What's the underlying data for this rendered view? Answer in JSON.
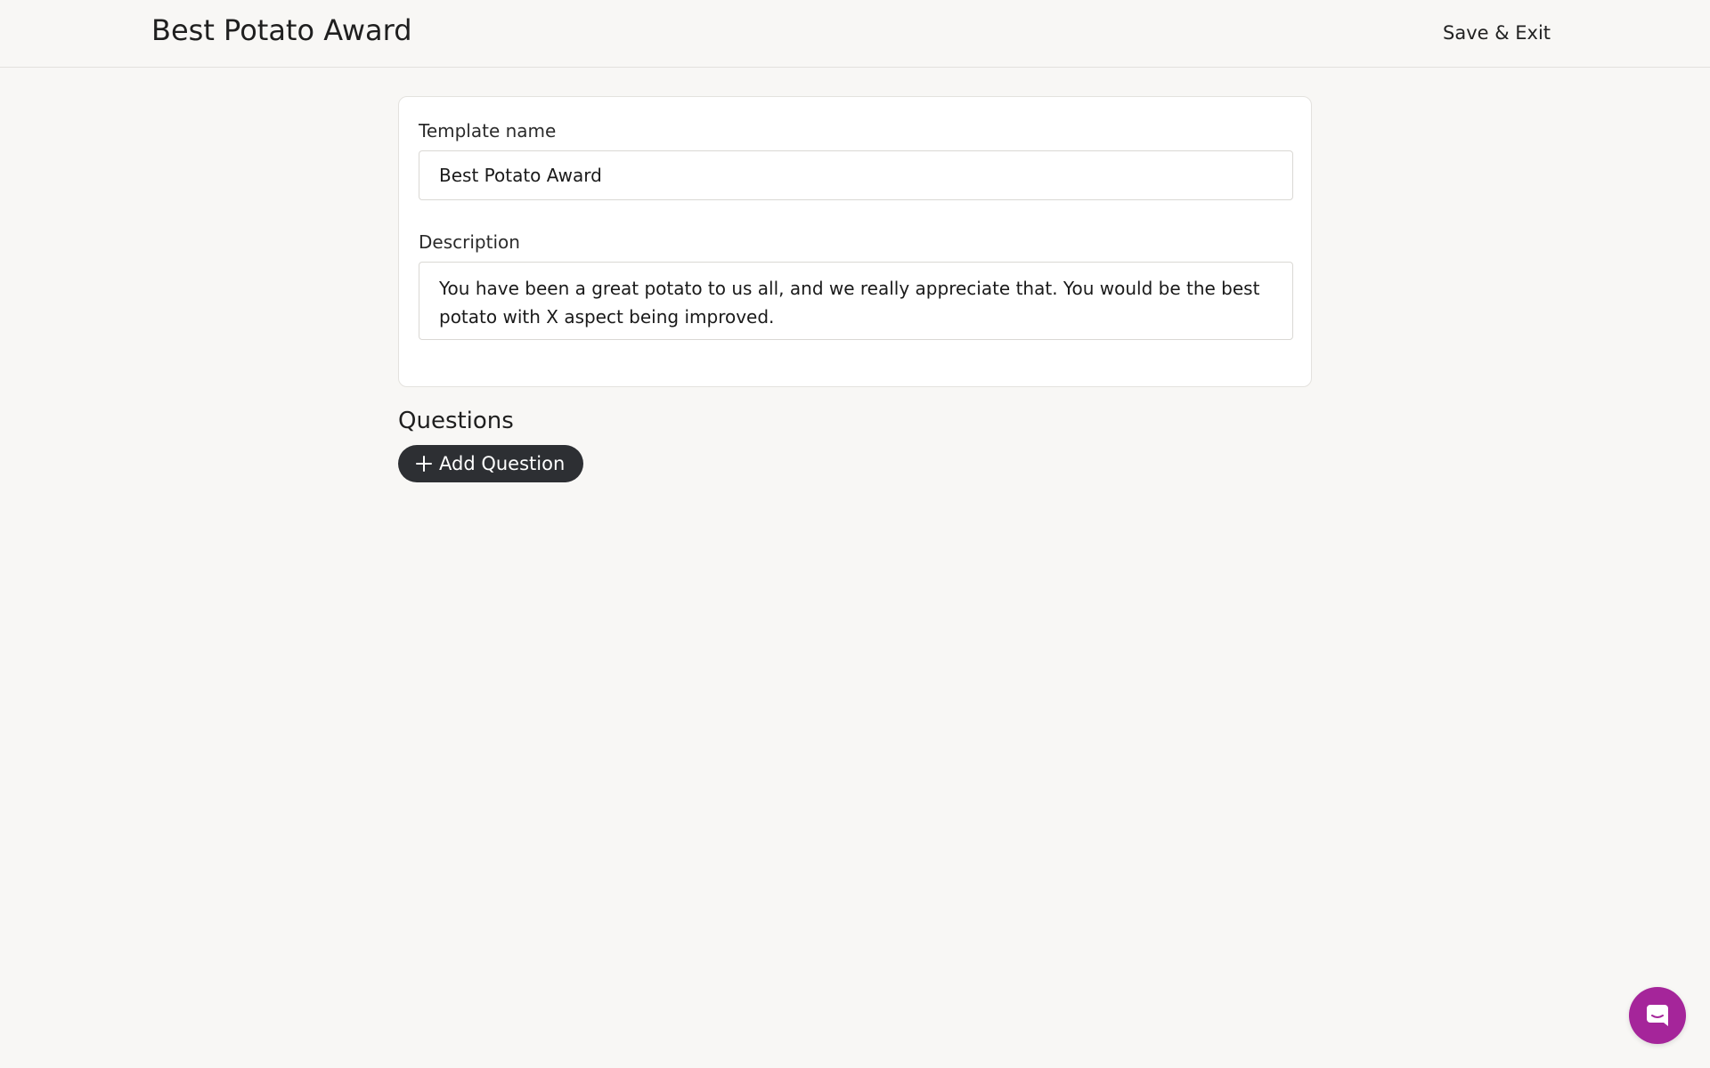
{
  "header": {
    "title": "Best Potato Award",
    "save_exit_label": "Save & Exit"
  },
  "form": {
    "template_name_label": "Template name",
    "template_name_value": "Best Potato Award",
    "description_label": "Description",
    "description_value": "You have been a great potato to us all, and we really appreciate that. You would be the best potato with X aspect being improved."
  },
  "questions": {
    "heading": "Questions",
    "add_button_label": "Add Question",
    "add_button_icon": "plus-icon"
  },
  "chat": {
    "icon": "chat-bubble-icon",
    "color": "#a5259a"
  },
  "colors": {
    "background": "#f8f7f5",
    "button_dark": "#2d2f33",
    "accent": "#a5259a"
  }
}
